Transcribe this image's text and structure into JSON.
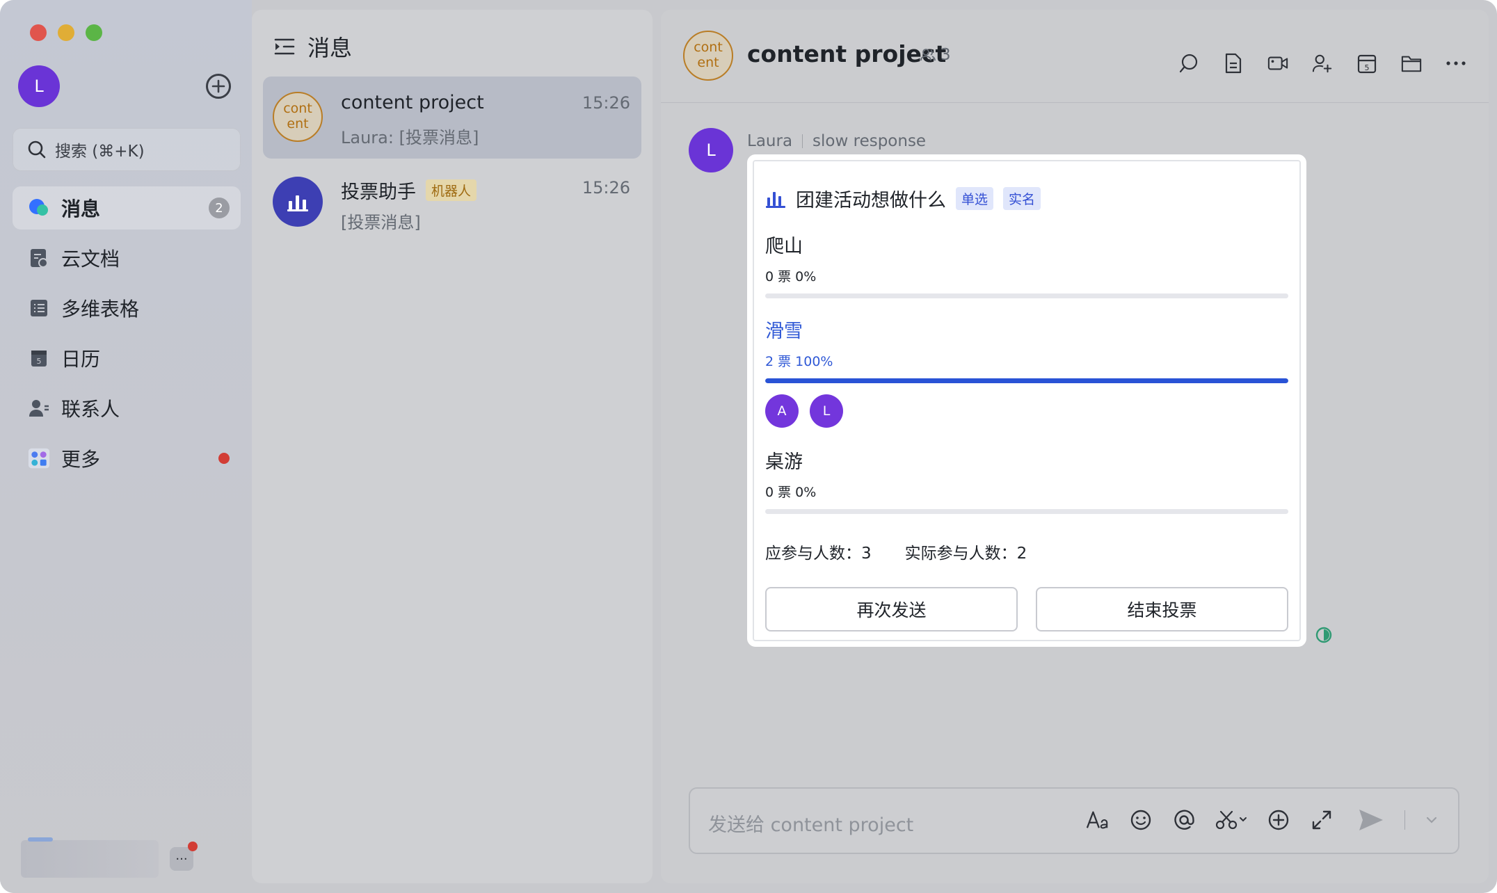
{
  "sidebar": {
    "user_initial": "L",
    "search_placeholder": "搜索 (⌘+K)",
    "items": [
      {
        "label": "消息",
        "badge": "2"
      },
      {
        "label": "云文档"
      },
      {
        "label": "多维表格"
      },
      {
        "label": "日历"
      },
      {
        "label": "联系人"
      },
      {
        "label": "更多"
      }
    ],
    "more_small": "···"
  },
  "chatlist": {
    "title": "消息",
    "chats": [
      {
        "name": "content project",
        "avatar_text": "cont ent",
        "time": "15:26",
        "preview": "Laura: [投票消息]"
      },
      {
        "name": "投票助手",
        "tag": "机器人",
        "time": "15:26",
        "preview": "[投票消息]"
      }
    ]
  },
  "chat": {
    "avatar_text": "cont ent",
    "title": "content project",
    "member_count": "3",
    "message": {
      "sender_initial": "L",
      "sender": "Laura",
      "status": "slow response",
      "vote": {
        "title": "团建活动想做什么",
        "tags": [
          "单选",
          "实名"
        ],
        "options": [
          {
            "name": "爬山",
            "stat": "0 票 0%",
            "percent": 0
          },
          {
            "name": "滑雪",
            "stat": "2 票 100%",
            "percent": 100,
            "voters": [
              "A",
              "L"
            ]
          },
          {
            "name": "桌游",
            "stat": "0 票 0%",
            "percent": 0
          }
        ],
        "expected": "应参与人数：3",
        "actual": "实际参与人数：2",
        "buttons": [
          "再次发送",
          "结束投票"
        ]
      }
    },
    "input_placeholder": "发送给 content project"
  },
  "colors": {
    "accent": "#2953d6",
    "avatar_purple": "#6a34d6",
    "bot_avatar": "#3d3fb3",
    "badge_red": "#d23d35"
  }
}
